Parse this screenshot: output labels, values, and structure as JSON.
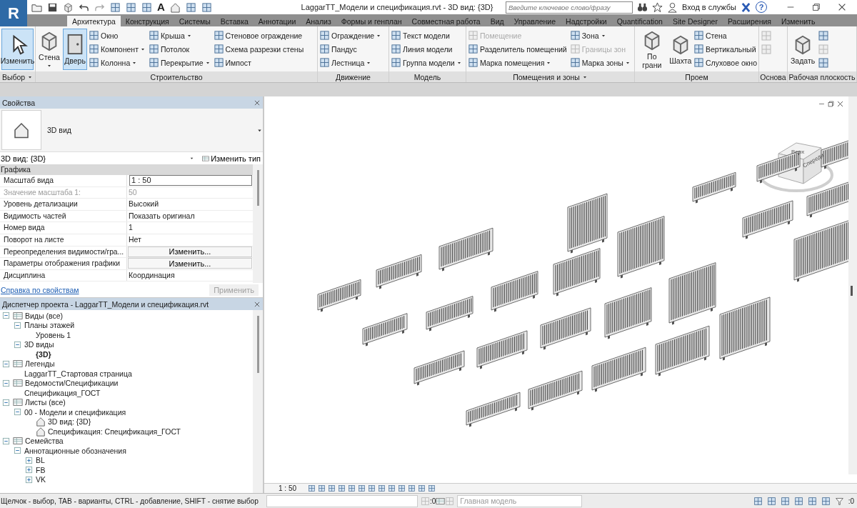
{
  "title_bar": {
    "app_button": "R",
    "text_tool": "A",
    "title": "LaggarTT_Модели и спецификация.rvt - 3D вид: {3D}",
    "search": {
      "placeholder": "Введите ключевое слово/фразу"
    },
    "sign_in": "Вход в службы",
    "help": "?"
  },
  "ribbon_tabs": [
    {
      "label": "Архитектура",
      "selected": true
    },
    {
      "label": "Конструкция",
      "selected": false
    },
    {
      "label": "Системы",
      "selected": false
    },
    {
      "label": "Вставка",
      "selected": false
    },
    {
      "label": "Аннотации",
      "selected": false
    },
    {
      "label": "Анализ",
      "selected": false
    },
    {
      "label": "Формы и генплан",
      "selected": false
    },
    {
      "label": "Совместная работа",
      "selected": false
    },
    {
      "label": "Вид",
      "selected": false
    },
    {
      "label": "Управление",
      "selected": false
    },
    {
      "label": "Надстройки",
      "selected": false
    },
    {
      "label": "Quantification",
      "selected": false
    },
    {
      "label": "Site Designer",
      "selected": false
    },
    {
      "label": "Расширения",
      "selected": false
    },
    {
      "label": "Изменить",
      "selected": false
    }
  ],
  "ribbon_panels": [
    {
      "title": "Выбор",
      "menu": true,
      "tools": [
        {
          "kind": "large",
          "label": "Изменить",
          "selected": true,
          "disabled": false,
          "dropdown": false
        }
      ]
    },
    {
      "title": "Строительство",
      "menu": false,
      "tools": [
        {
          "kind": "large",
          "label": "Стена",
          "selected": false,
          "disabled": false,
          "dropdown": true
        },
        {
          "kind": "large",
          "label": "Дверь",
          "selected": true,
          "disabled": false,
          "dropdown": false
        },
        {
          "kind": "small",
          "label": "Окно",
          "selected": false,
          "disabled": false,
          "dropdown": false
        },
        {
          "kind": "small",
          "label": "Компонент",
          "selected": false,
          "disabled": false,
          "dropdown": true
        },
        {
          "kind": "small",
          "label": "Колонна",
          "selected": false,
          "disabled": false,
          "dropdown": true
        },
        {
          "kind": "small",
          "label": "Крыша",
          "selected": false,
          "disabled": false,
          "dropdown": true
        },
        {
          "kind": "small",
          "label": "Потолок",
          "selected": false,
          "disabled": false,
          "dropdown": false
        },
        {
          "kind": "small",
          "label": "Перекрытие",
          "selected": false,
          "disabled": false,
          "dropdown": true
        },
        {
          "kind": "small",
          "label": "Стеновое ограждение",
          "selected": false,
          "disabled": false,
          "dropdown": false
        },
        {
          "kind": "small",
          "label": "Схема разрезки стены",
          "selected": false,
          "disabled": false,
          "dropdown": false
        },
        {
          "kind": "small",
          "label": "Импост",
          "selected": false,
          "disabled": false,
          "dropdown": false
        }
      ]
    },
    {
      "title": "Движение",
      "menu": false,
      "tools": [
        {
          "kind": "small",
          "label": "Ограждение",
          "selected": false,
          "disabled": false,
          "dropdown": true
        },
        {
          "kind": "small",
          "label": "Пандус",
          "selected": false,
          "disabled": false,
          "dropdown": false
        },
        {
          "kind": "small",
          "label": "Лестница",
          "selected": false,
          "disabled": false,
          "dropdown": true
        }
      ]
    },
    {
      "title": "Модель",
      "menu": false,
      "tools": [
        {
          "kind": "small",
          "label": "Текст модели",
          "selected": false,
          "disabled": false,
          "dropdown": false
        },
        {
          "kind": "small",
          "label": "Линия модели",
          "selected": false,
          "disabled": false,
          "dropdown": false
        },
        {
          "kind": "small",
          "label": "Группа модели",
          "selected": false,
          "disabled": false,
          "dropdown": true
        }
      ]
    },
    {
      "title": "Помещения и зоны",
      "menu": true,
      "tools": [
        {
          "kind": "small",
          "label": "Помещение",
          "selected": false,
          "disabled": true,
          "dropdown": false
        },
        {
          "kind": "small",
          "label": "Разделитель помещений",
          "selected": false,
          "disabled": false,
          "dropdown": false
        },
        {
          "kind": "small",
          "label": "Марка помещения",
          "selected": false,
          "disabled": false,
          "dropdown": true
        },
        {
          "kind": "small",
          "label": "Зона",
          "selected": false,
          "disabled": false,
          "dropdown": true
        },
        {
          "kind": "small",
          "label": "Границы зон",
          "selected": false,
          "disabled": true,
          "dropdown": false
        },
        {
          "kind": "small",
          "label": "Марка зоны",
          "selected": false,
          "disabled": false,
          "dropdown": true
        }
      ]
    },
    {
      "title": "Проем",
      "menu": false,
      "tools": [
        {
          "kind": "large",
          "label": "По грани",
          "selected": false,
          "disabled": false,
          "dropdown": false
        },
        {
          "kind": "large",
          "label": "Шахта",
          "selected": false,
          "disabled": false,
          "dropdown": false
        },
        {
          "kind": "small",
          "label": "Стена",
          "selected": false,
          "disabled": false,
          "dropdown": false
        },
        {
          "kind": "small",
          "label": "Вертикальный",
          "selected": false,
          "disabled": false,
          "dropdown": false
        },
        {
          "kind": "small",
          "label": "Слуховое окно",
          "selected": false,
          "disabled": false,
          "dropdown": false
        }
      ]
    },
    {
      "title": "Основа",
      "menu": false,
      "tools": [
        {
          "kind": "icon",
          "selected": false,
          "disabled": true,
          "dropdown": false
        },
        {
          "kind": "icon",
          "selected": false,
          "disabled": true,
          "dropdown": false
        }
      ]
    },
    {
      "title": "Рабочая плоскость",
      "menu": false,
      "tools": [
        {
          "kind": "large",
          "label": "Задать",
          "selected": false,
          "disabled": false,
          "dropdown": false
        },
        {
          "kind": "icon",
          "selected": false,
          "disabled": false,
          "dropdown": false
        },
        {
          "kind": "icon",
          "selected": false,
          "disabled": true,
          "dropdown": false
        },
        {
          "kind": "icon",
          "selected": false,
          "disabled": false,
          "dropdown": false
        }
      ]
    }
  ],
  "properties": {
    "title": "Свойства",
    "type_name": "3D вид",
    "instance": "3D вид: {3D}",
    "edit_type": "Изменить тип",
    "group": "Графика",
    "rows": [
      {
        "name": "Масштаб вида",
        "value": "1 : 50",
        "kind": "field",
        "disabled": false
      },
      {
        "name": "Значение масштаба    1:",
        "value": "50",
        "kind": "text",
        "disabled": true
      },
      {
        "name": "Уровень детализации",
        "value": "Высокий",
        "kind": "text",
        "disabled": false
      },
      {
        "name": "Видимость частей",
        "value": "Показать оригинал",
        "kind": "text",
        "disabled": false
      },
      {
        "name": "Номер вида",
        "value": "1",
        "kind": "text",
        "disabled": false
      },
      {
        "name": "Поворот на листе",
        "value": "Нет",
        "kind": "text",
        "disabled": false
      },
      {
        "name": "Переопределения видимости/гра...",
        "value": "Изменить...",
        "kind": "button",
        "disabled": false
      },
      {
        "name": "Параметры отображения графики",
        "value": "Изменить...",
        "kind": "button",
        "disabled": false
      },
      {
        "name": "Дисциплина",
        "value": "Координация",
        "kind": "text",
        "disabled": false
      }
    ],
    "help_link": "Справка по свойствам",
    "apply": "Применить"
  },
  "project_browser": {
    "title": "Диспетчер проекта - LaggarTT_Модели и спецификация.rvt",
    "tree": [
      {
        "label": "Виды (все)",
        "expanded": true,
        "icon": true,
        "active": false,
        "children": [
          {
            "label": "Планы этажей",
            "expanded": true,
            "icon": false,
            "active": false,
            "children": [
              {
                "label": "Уровень 1",
                "icon": false,
                "active": false
              }
            ]
          },
          {
            "label": "3D виды",
            "expanded": true,
            "icon": false,
            "active": false,
            "children": [
              {
                "label": "{3D}",
                "icon": false,
                "active": true
              }
            ]
          }
        ]
      },
      {
        "label": "Легенды",
        "expanded": true,
        "icon": true,
        "active": false,
        "children": [
          {
            "label": "LaggarTT_Стартовая страница",
            "icon": false,
            "active": false
          }
        ]
      },
      {
        "label": "Ведомости/Спецификации",
        "expanded": true,
        "icon": true,
        "active": false,
        "children": [
          {
            "label": "Спецификация_ГОСТ",
            "icon": false,
            "active": false
          }
        ]
      },
      {
        "label": "Листы (все)",
        "expanded": true,
        "icon": true,
        "active": false,
        "children": [
          {
            "label": "00 - Модели и спецификация",
            "expanded": true,
            "icon": false,
            "active": false,
            "children": [
              {
                "label": "3D вид: {3D}",
                "icon": true,
                "active": false
              },
              {
                "label": "Спецификация: Спецификация_ГОСТ",
                "icon": true,
                "active": false
              }
            ]
          }
        ]
      },
      {
        "label": "Семейства",
        "expanded": true,
        "icon": true,
        "active": false,
        "children": [
          {
            "label": "Аннотационные обозначения",
            "expanded": true,
            "icon": false,
            "active": false,
            "children": [
              {
                "label": "BL",
                "expanded": false,
                "icon": false,
                "active": false
              },
              {
                "label": "FB",
                "expanded": false,
                "icon": false,
                "active": false
              },
              {
                "label": "VK",
                "expanded": false,
                "icon": false,
                "active": false
              }
            ]
          }
        ]
      }
    ]
  },
  "viewport": {
    "view_cube": {
      "top": "Верх",
      "front": "Спереди"
    },
    "scale": "1 : 50"
  },
  "status_bar": {
    "hint": "Щелчок - выбор, TAB - варианты, CTRL - добавление, SHIFT - снятие выбор",
    "workset_count": ":0",
    "model": "Главная модель",
    "filter_count": ":0"
  }
}
